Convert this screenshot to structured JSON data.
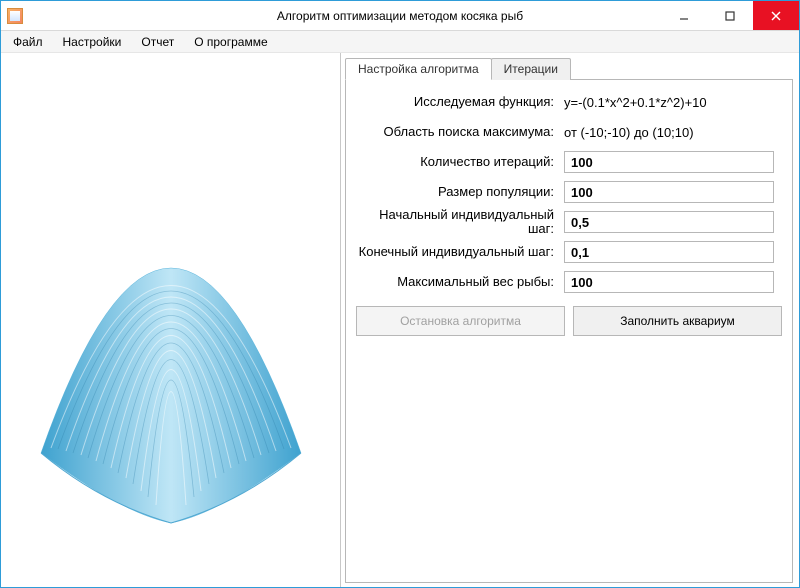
{
  "window": {
    "title": "Алгоритм оптимизации методом косяка рыб"
  },
  "menu": {
    "file": "Файл",
    "settings": "Настройки",
    "report": "Отчет",
    "about": "О программе"
  },
  "tabs": {
    "algorithm": "Настройка алгоритма",
    "iterations": "Итерации"
  },
  "form": {
    "function_label": "Исследуемая функция:",
    "function_value": "y=-(0.1*x^2+0.1*z^2)+10",
    "region_label": "Область поиска максимума:",
    "region_value": "от (-10;-10) до (10;10)",
    "iterations_label": "Количество итераций:",
    "iterations_value": "100",
    "population_label": "Размер популяции:",
    "population_value": "100",
    "initstep_label": "Начальный индивидуальный шаг:",
    "initstep_value": "0,5",
    "finalstep_label": "Конечный индивидуальный шаг:",
    "finalstep_value": "0,1",
    "maxweight_label": "Максимальный вес рыбы:",
    "maxweight_value": "100"
  },
  "buttons": {
    "stop": "Остановка алгоритма",
    "fill": "Заполнить аквариум"
  },
  "chart_data": {
    "type": "surface",
    "function": "y = -(0.1*x^2 + 0.1*z^2) + 10",
    "x_range": [
      -10,
      10
    ],
    "z_range": [
      -10,
      10
    ],
    "y_range": [
      -10,
      10
    ],
    "description": "Downward-opening paraboloid surface, apex at (0,0,10)"
  }
}
